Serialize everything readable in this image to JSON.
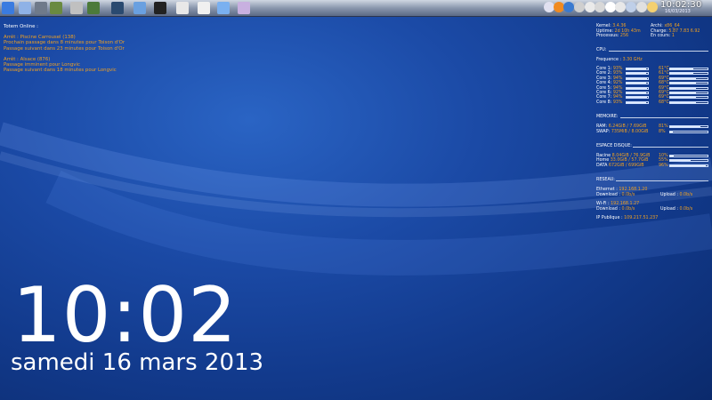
{
  "panel": {
    "launchers": [
      {
        "name": "kde-menu-icon",
        "color": "#3a7be0"
      },
      {
        "name": "desktop-grid-icon",
        "color": "#8fb2e6"
      },
      {
        "name": "display-icon",
        "color": "#6f7a8a"
      },
      {
        "name": "media-player-icon",
        "color": "#6a8a40"
      },
      {
        "name": "calculator-icon",
        "color": "#c0c0c0"
      },
      {
        "name": "spreadsheet-icon",
        "color": "#4c7a3a"
      },
      {
        "name": "terminal-monitor-icon",
        "color": "#2a4a70"
      },
      {
        "name": "folder-icon",
        "color": "#6aa0e0"
      },
      {
        "name": "console-icon",
        "color": "#222222"
      },
      {
        "name": "tux-penguin-icon",
        "color": "#e8e8e8"
      },
      {
        "name": "cloud-sheep-icon",
        "color": "#f0f0f0"
      },
      {
        "name": "bottle-icon",
        "color": "#7ab0f0"
      },
      {
        "name": "edit-document-icon",
        "color": "#c8b0e0"
      }
    ],
    "tray": [
      "notification-icon",
      "firefox-icon",
      "globe-icon",
      "device-icon",
      "chat-icon",
      "battery-icon",
      "x-app-icon",
      "volume-icon",
      "keyboard-icon",
      "network-icon",
      "weather-icon"
    ],
    "clock_time": "10:02:30",
    "clock_date": "16/03/2013"
  },
  "totem": {
    "title": "Totem Online :",
    "stop1": "Arrêt : Piscine Carrousel  (138)",
    "stop1_l1": "Prochain passage dans 8 minutes pour Toison d'Or",
    "stop1_l2": "Passage suivant dans 23 minutes pour Toison d'Or",
    "stop2": "Arrêt : Alsace  (876)",
    "stop2_l1": "Passage imminent pour Longvic",
    "stop2_l2": "Passage suivant dans 18 minutes pour Longvic"
  },
  "big_clock": {
    "time": "10:02",
    "date": "samedi 16 mars 2013"
  },
  "sys": {
    "kernel_label": "Kernel:",
    "kernel": "3.4.36",
    "uptime_label": "Uptime:",
    "uptime": "2d 10h 43m",
    "procs_label": "Processus:",
    "procs": "256",
    "arch_label": "Archi:",
    "arch": "x86_64",
    "charge_label": "Charge:",
    "charge": "5.87 7.83 6.92",
    "encours_label": "En cours:",
    "encours": "1"
  },
  "cpu": {
    "title": "CPU:",
    "freq_label": "Frequence :",
    "freq": "3.30 GHz",
    "cores": [
      {
        "label": "Core 1:",
        "pct": "93%",
        "usage": 0.93,
        "temp": "61°C",
        "tempv": 0.61
      },
      {
        "label": "Core 2:",
        "pct": "93%",
        "usage": 0.93,
        "temp": "61°C",
        "tempv": 0.61
      },
      {
        "label": "Core 3:",
        "pct": "94%",
        "usage": 0.94,
        "temp": "69°C",
        "tempv": 0.69
      },
      {
        "label": "Core 4:",
        "pct": "92%",
        "usage": 0.92,
        "temp": "68°C",
        "tempv": 0.68
      },
      {
        "label": "Core 5:",
        "pct": "94%",
        "usage": 0.94,
        "temp": "69°C",
        "tempv": 0.69
      },
      {
        "label": "Core 6:",
        "pct": "92%",
        "usage": 0.92,
        "temp": "69°C",
        "tempv": 0.69
      },
      {
        "label": "Core 7:",
        "pct": "94%",
        "usage": 0.94,
        "temp": "69°C",
        "tempv": 0.69
      },
      {
        "label": "Core 8:",
        "pct": "93%",
        "usage": 0.93,
        "temp": "68°C",
        "tempv": 0.68
      }
    ]
  },
  "memory": {
    "title": "MEMOIRE:",
    "ram_label": "RAM:",
    "ram": "6.24GiB / 7.69GiB",
    "ram_pct": "81%",
    "ram_v": 0.81,
    "swap_label": "SWAP:",
    "swap": "735MiB / 8.00GiB",
    "swap_pct": "8%",
    "swap_v": 0.08
  },
  "disk": {
    "title": "ESPACE DISQUE:",
    "rows": [
      {
        "label": "Racine",
        "val": "8.04GiB / 76.9GiB",
        "pct": "10%",
        "v": 0.1
      },
      {
        "label": "Home",
        "val": "33.0GiB / 57.7GiB",
        "pct": "55%",
        "v": 0.55
      },
      {
        "label": "DATA",
        "val": "672GiB / 699GiB",
        "pct": "96%",
        "v": 0.96
      }
    ]
  },
  "network": {
    "title": "RESEAU:",
    "eth_label": "Ethernet :",
    "eth_ip": "192.168.1.20",
    "eth_dl_label": "Download :",
    "eth_dl": "0.0b/s",
    "eth_ul_label": "Upload :",
    "eth_ul": "0.0b/s",
    "wifi_label": "Wi-Fi :",
    "wifi_ip": "192.168.1.27",
    "wifi_dl_label": "Download :",
    "wifi_dl": "0.0b/s",
    "wifi_ul_label": "Upload :",
    "wifi_ul": "0.0b/s",
    "pub_label": "IP Publique :",
    "pub_ip": "109.217.51.237"
  }
}
